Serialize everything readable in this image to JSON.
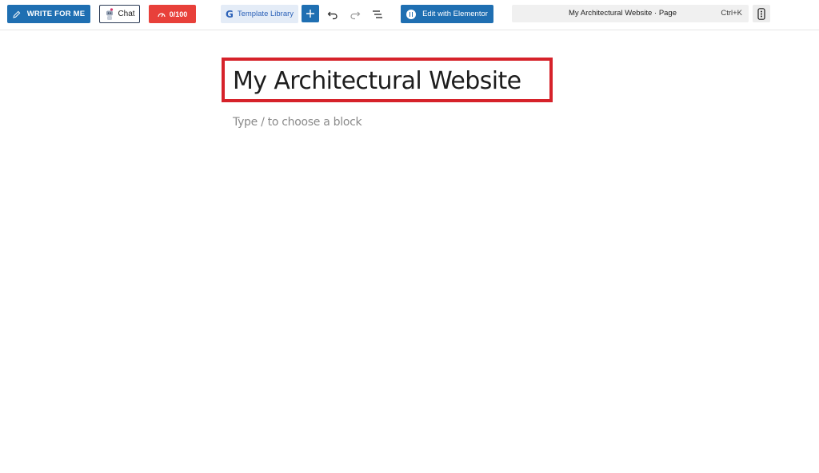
{
  "toolbar": {
    "write_label": "WRITE FOR ME",
    "chat_label": "Chat",
    "score_label": "0/100",
    "template_label": "Template Library",
    "elementor_label": "Edit with Elementor",
    "icons": {
      "write": "pencil-icon",
      "chat": "robot-icon",
      "score": "gauge-icon",
      "template": "template-library-logo-icon",
      "add": "plus-icon",
      "undo": "undo-icon",
      "redo": "redo-icon",
      "list_view": "list-view-icon",
      "elementor": "elementor-logo-icon",
      "options": "more-vertical-icon"
    }
  },
  "command_bar": {
    "doc_title": "My Architectural Website",
    "doc_type": "Page",
    "shortcut": "Ctrl+K"
  },
  "editor": {
    "title": "My Architectural Website",
    "placeholder": "Type / to choose a block"
  },
  "colors": {
    "primary_blue": "#1f6fb2",
    "score_red": "#e8403a",
    "highlight_red": "#d6222a",
    "template_bg": "#e4ecf7"
  }
}
